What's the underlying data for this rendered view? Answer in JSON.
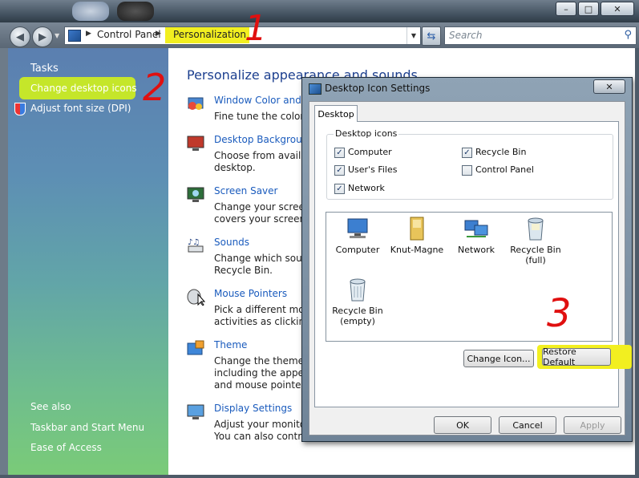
{
  "window": {
    "buttons": {
      "minimize": "–",
      "maximize": "□",
      "close": "✕"
    }
  },
  "address": {
    "crumbs": [
      "Control Panel",
      "Personalization"
    ],
    "search_placeholder": "Search"
  },
  "left_pane": {
    "tasks_heading": "Tasks",
    "tasks": [
      "Change desktop icons",
      "Adjust font size (DPI)"
    ],
    "see_also_heading": "See also",
    "see_also": [
      "Taskbar and Start Menu",
      "Ease of Access"
    ]
  },
  "main": {
    "heading": "Personalize appearance and sounds",
    "items": [
      {
        "title": "Window Color and A",
        "desc": [
          "Fine tune the color a"
        ],
        "icon": "window-color-icon"
      },
      {
        "title": "Desktop Background",
        "desc": [
          "Choose from availab",
          "desktop."
        ],
        "icon": "desktop-background-icon"
      },
      {
        "title": "Screen Saver",
        "desc": [
          "Change your screen",
          "covers your screen a"
        ],
        "icon": "screen-saver-icon"
      },
      {
        "title": "Sounds",
        "desc": [
          "Change which sound",
          "Recycle Bin."
        ],
        "icon": "sounds-icon"
      },
      {
        "title": "Mouse Pointers",
        "desc": [
          "Pick a different mous",
          "activities as clicking a"
        ],
        "icon": "mouse-pointers-icon"
      },
      {
        "title": "Theme",
        "desc": [
          "Change the theme. T",
          "including the appear",
          "and mouse pointers."
        ],
        "icon": "theme-icon"
      },
      {
        "title": "Display Settings",
        "desc": [
          "Adjust your monitor",
          "You can also control"
        ],
        "icon": "display-settings-icon"
      }
    ]
  },
  "dialog": {
    "title": "Desktop Icon Settings",
    "close": "✕",
    "tab": "Desktop",
    "group_label": "Desktop icons",
    "checkboxes": [
      {
        "label": "Computer",
        "checked": true
      },
      {
        "label": "Recycle Bin",
        "checked": true
      },
      {
        "label": "User's Files",
        "checked": true
      },
      {
        "label": "Control Panel",
        "checked": false
      },
      {
        "label": "Network",
        "checked": true
      }
    ],
    "icons": [
      {
        "label": "Computer",
        "icon": "computer-icon"
      },
      {
        "label": "Knut-Magne",
        "icon": "user-folder-icon"
      },
      {
        "label": "Network",
        "icon": "network-icon"
      },
      {
        "label": "Recycle Bin\n(full)",
        "icon": "recycle-bin-full-icon"
      },
      {
        "label": "Recycle Bin\n(empty)",
        "icon": "recycle-bin-empty-icon"
      }
    ],
    "change_icon": "Change Icon...",
    "restore_default": "Restore Default",
    "ok": "OK",
    "cancel": "Cancel",
    "apply": "Apply"
  },
  "annotations": {
    "step1": "1",
    "step2": "2",
    "step3": "3",
    "color": "#e01010",
    "highlight": "#f2ef20"
  }
}
